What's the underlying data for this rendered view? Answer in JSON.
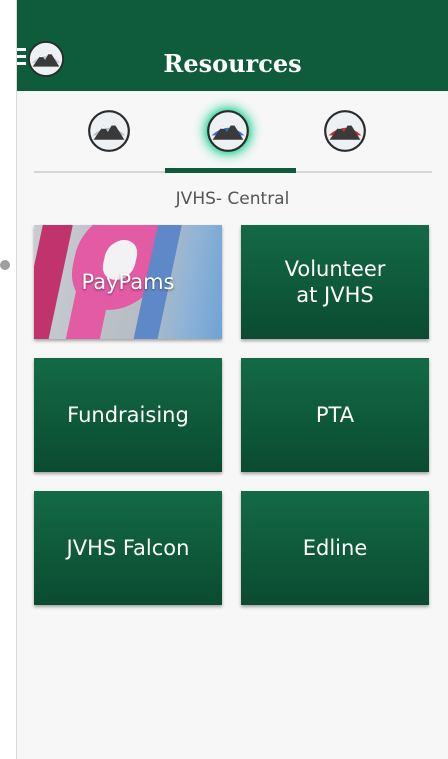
{
  "header": {
    "title": "Resources"
  },
  "schools": {
    "icons": [
      {
        "name": "mountain-logo-gray",
        "accent": "#b8c2cc"
      },
      {
        "name": "mountain-logo-blue",
        "accent": "#2f6fd6",
        "selected": true
      },
      {
        "name": "mountain-logo-red",
        "accent": "#d62f3a"
      }
    ],
    "current": "JVHS- Central"
  },
  "tiles": [
    {
      "label": "PayPams"
    },
    {
      "label": "Volunteer\nat JVHS"
    },
    {
      "label": "Fundraising"
    },
    {
      "label": "PTA"
    },
    {
      "label": "JVHS Falcon"
    },
    {
      "label": "Edline"
    }
  ],
  "colors": {
    "header_green": "#0f5c3c",
    "tile_green": "#0d5a3b",
    "glow": "#2fd49a"
  }
}
